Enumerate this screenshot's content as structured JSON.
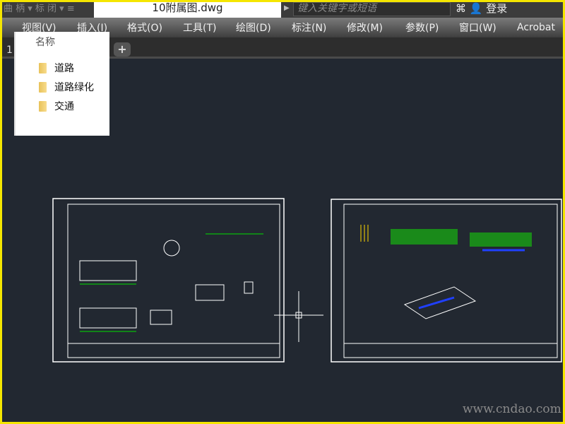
{
  "titlebar": {
    "quick_access": "曲 柄 ▾ 标 闭 ▾ ≡",
    "document_title": "10附属图.dwg",
    "search_placeholder": "键入关键字或短语",
    "login": "登录"
  },
  "menu": [
    "视图(V)",
    "插入(I)",
    "格式(O)",
    "工具(T)",
    "绘图(D)",
    "标注(N)",
    "修改(M)",
    "参数(P)",
    "窗口(W)",
    "Acrobat"
  ],
  "tabs": {
    "first": "1",
    "add": "+"
  },
  "popup": {
    "header": "名称",
    "items": [
      "道路",
      "道路绿化",
      "交通"
    ]
  },
  "watermark": "www.cndao.com",
  "colors": {
    "canvas": "#222831",
    "border": "#f5e600",
    "lines": "#ffffff",
    "accent": "#00ff00"
  }
}
